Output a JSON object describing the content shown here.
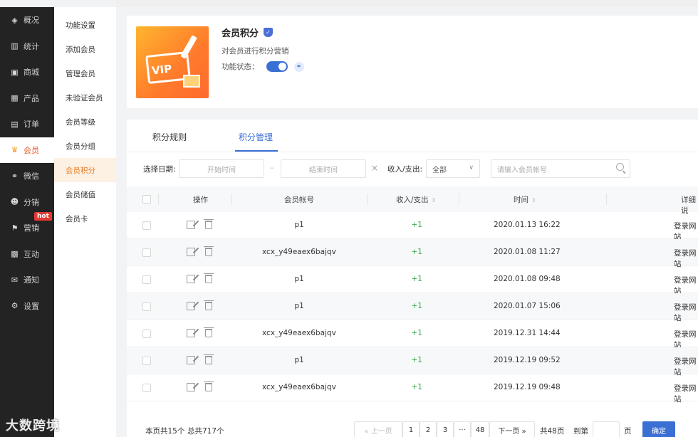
{
  "sidebar": {
    "items": [
      {
        "label": "概况",
        "icon": "layers-icon",
        "glyph": "◈"
      },
      {
        "label": "统计",
        "icon": "chart-icon",
        "glyph": "▥"
      },
      {
        "label": "商城",
        "icon": "mail-icon",
        "glyph": "▣"
      },
      {
        "label": "产品",
        "icon": "grid-icon",
        "glyph": "▦"
      },
      {
        "label": "订单",
        "icon": "clipboard-icon",
        "glyph": "▤"
      },
      {
        "label": "会员",
        "icon": "crown-icon",
        "glyph": "♛",
        "active": true
      },
      {
        "label": "微信",
        "icon": "link-icon",
        "glyph": "⚭"
      },
      {
        "label": "分销",
        "icon": "users-icon",
        "glyph": "☻"
      },
      {
        "label": "营销",
        "icon": "flag-icon",
        "glyph": "⚑",
        "badge": "hot"
      },
      {
        "label": "互动",
        "icon": "blocks-icon",
        "glyph": "▩"
      },
      {
        "label": "通知",
        "icon": "envelope-icon",
        "glyph": "✉"
      },
      {
        "label": "设置",
        "icon": "gear-icon",
        "glyph": "⚙"
      }
    ]
  },
  "submenu": {
    "items": [
      {
        "label": "功能设置"
      },
      {
        "label": "添加会员"
      },
      {
        "label": "管理会员"
      },
      {
        "label": "未验证会员"
      },
      {
        "label": "会员等级"
      },
      {
        "label": "会员分组"
      },
      {
        "label": "会员积分",
        "active": true
      },
      {
        "label": "会员储值"
      },
      {
        "label": "会员卡"
      }
    ]
  },
  "header": {
    "title": "会员积分",
    "image_text": "VIP",
    "description": "对会员进行积分营销",
    "status_label": "功能状态：",
    "status_on": true
  },
  "tabs": [
    {
      "label": "积分规则"
    },
    {
      "label": "积分管理",
      "active": true
    }
  ],
  "filters": {
    "date_label": "选择日期:",
    "start_placeholder": "开始时间",
    "dash": "–",
    "end_placeholder": "结束时间",
    "clear": "×",
    "type_label": "收入/支出:",
    "type_value": "全部",
    "account_placeholder": "请输入会员帐号"
  },
  "table": {
    "columns": [
      "操作",
      "会员帐号",
      "收入/支出",
      "时间",
      "详细说"
    ],
    "rows": [
      {
        "account": "p1",
        "amount": "+1",
        "time": "2020.01.13 16:22",
        "detail": "登录网站"
      },
      {
        "account": "xcx_y49eaex6bajqv",
        "amount": "+1",
        "time": "2020.01.08 11:27",
        "detail": "登录网站"
      },
      {
        "account": "p1",
        "amount": "+1",
        "time": "2020.01.08 09:48",
        "detail": "登录网站"
      },
      {
        "account": "p1",
        "amount": "+1",
        "time": "2020.01.07 15:06",
        "detail": "登录网站"
      },
      {
        "account": "xcx_y49eaex6bajqv",
        "amount": "+1",
        "time": "2019.12.31 14:44",
        "detail": "登录网站"
      },
      {
        "account": "p1",
        "amount": "+1",
        "time": "2019.12.19 09:52",
        "detail": "登录网站"
      },
      {
        "account": "xcx_y49eaex6bajqv",
        "amount": "+1",
        "time": "2019.12.19 09:48",
        "detail": "登录网站"
      }
    ]
  },
  "pager": {
    "page_count_text": "本页共15个",
    "total_text": "总共717个",
    "prev": "« 上一页",
    "pages": [
      "1",
      "2",
      "3",
      "···",
      "48"
    ],
    "next": "下一页 »",
    "total_pages": "共48页",
    "goto_label": "到第",
    "page_unit": "页",
    "confirm": "确定"
  },
  "watermark": "大数跨境",
  "colors": {
    "accent": "#3a6fd4",
    "sidebar_bg": "#232323",
    "active_orange": "#e77a22",
    "positive": "#3aa84a"
  }
}
